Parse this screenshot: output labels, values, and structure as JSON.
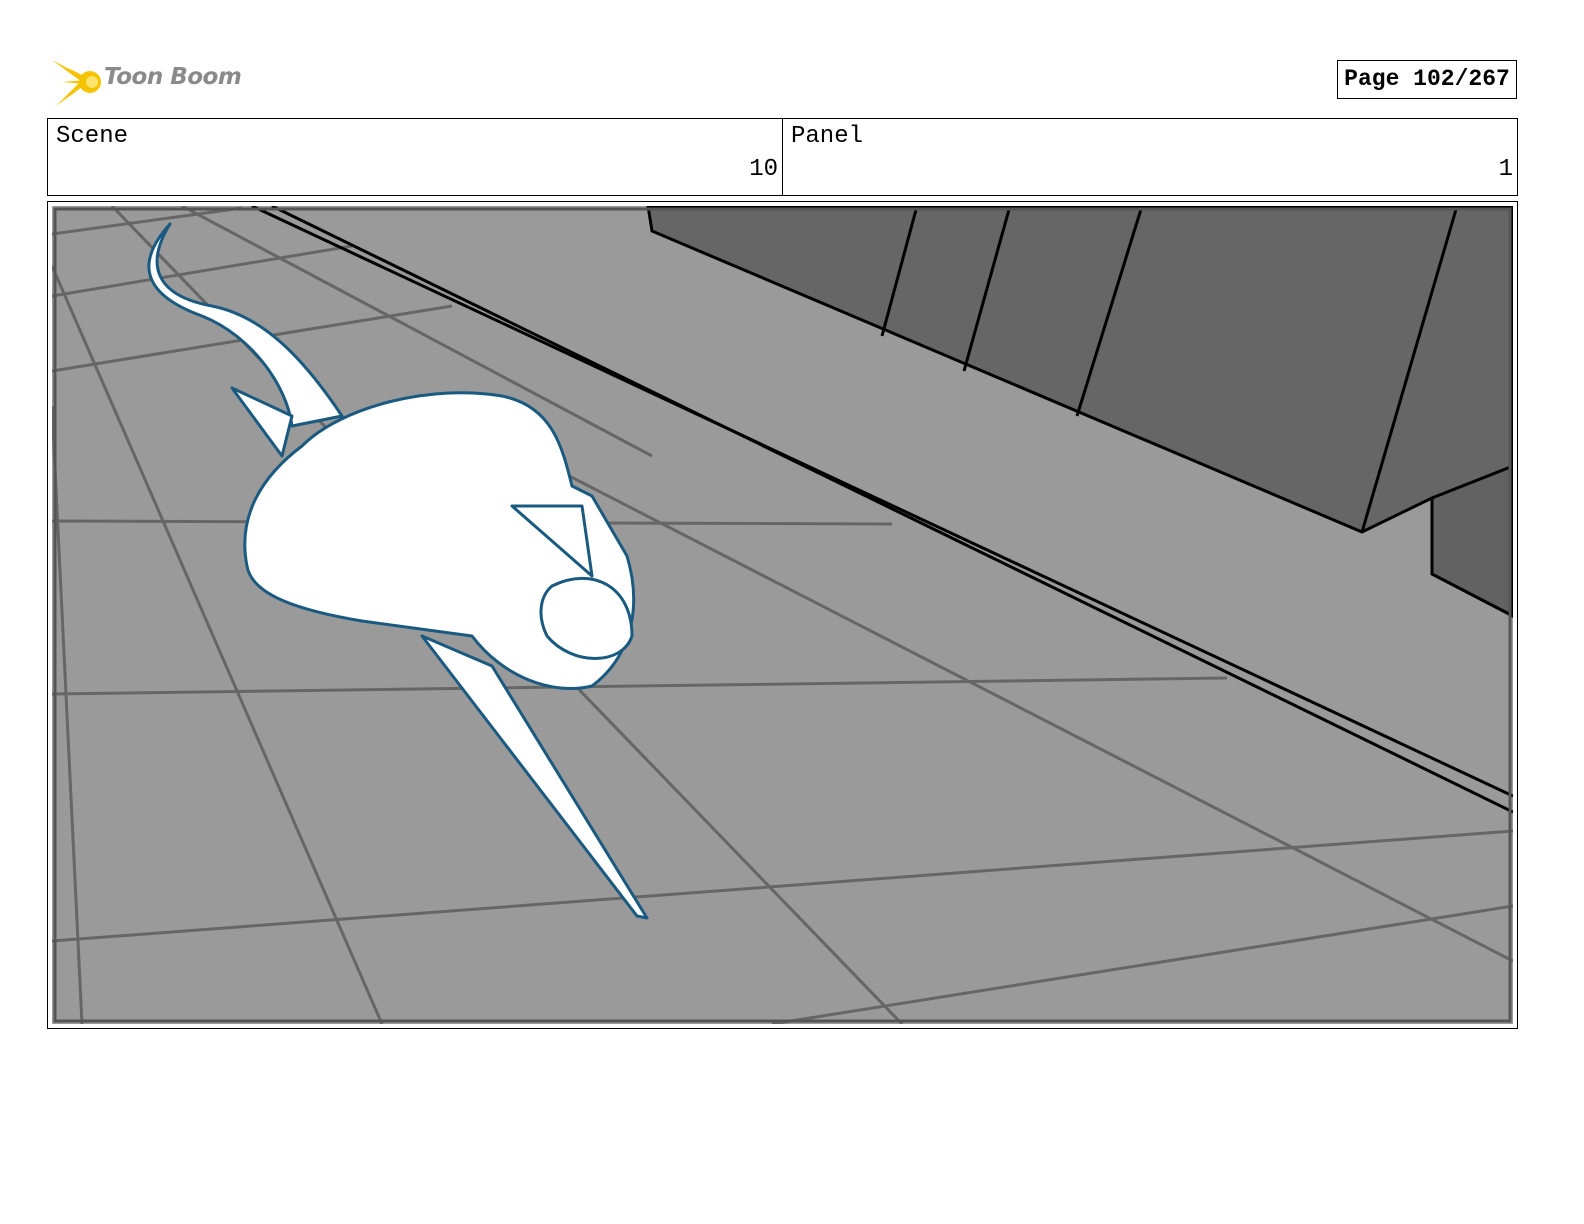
{
  "header": {
    "logo_text": "Toon Boom",
    "page_label": "Page 102/267"
  },
  "info": {
    "scene_label": "Scene",
    "scene_value": "10",
    "panel_label": "Panel",
    "panel_value": "1"
  },
  "colors": {
    "floor": "#9a9a9a",
    "wall": "#666666",
    "sketch_line": "#1a5a80",
    "logo_accent": "#f5c400"
  }
}
